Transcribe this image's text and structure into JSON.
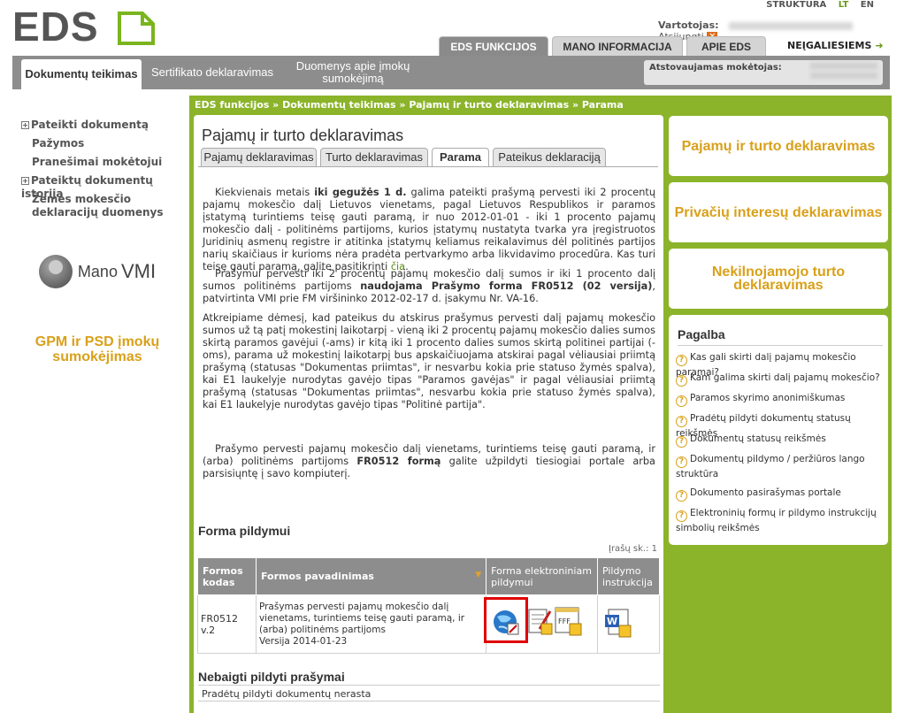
{
  "header": {
    "logo_text": "EDS",
    "top_links": [
      "STRUKTŪRA",
      "LT",
      "EN"
    ],
    "user_label": "Vartotojas:",
    "logout": "Atsijungti",
    "main_tabs": [
      "EDS FUNKCIJOS",
      "MANO INFORMACIJA",
      "APIE EDS"
    ],
    "accessibility": "NEĮGALIESIEMS",
    "sub_tabs": [
      "Dokumentų teikimas",
      "Sertifikato deklaravimas",
      "Duomenys apie įmokų sumokėjimą"
    ],
    "taxpayer_label": "Atstovaujamas mokėtojas:"
  },
  "sidebar": {
    "items": [
      "Pateikti dokumentą",
      "Pažymos",
      "Pranešimai mokėtojui",
      "Pateiktų dokumentų istorija",
      "Žemės mokesčio deklaracijų duomenys"
    ],
    "vmi_mano": "Mano",
    "vmi_name": "VMI",
    "gpm_box": "GPM ir PSD įmokų sumokėjimas"
  },
  "breadcrumb": "EDS funkcijos » Dokumentų teikimas » Pajamų ir turto deklaravimas » Parama",
  "page_title": "Pajamų ir turto deklaravimas",
  "content_tabs": [
    "Pajamų deklaravimas",
    "Turto deklaravimas",
    "Parama",
    "Pateikus deklaraciją"
  ],
  "paragraphs": {
    "p1_a": "Kiekvienais metais ",
    "p1_b": "iki gegužės 1 d.",
    "p1_c": " galima pateikti prašymą pervesti iki 2 procentų pajamų mokesčio dalį Lietuvos vienetams, pagal Lietuvos Respublikos ir paramos įstatymą turintiems teisę gauti paramą, ir nuo 2012-01-01 - iki 1 procento pajamų mokesčio dalį - politinėms partijoms, kurios įstatymų nustatyta tvarka yra įregistruotos Juridinių asmenų registre ir atitinka įstatymų keliamus reikalavimus dėl politinės partijos narių skaičiaus ir kurioms nėra pradėta pertvarkymo arba likvidavimo procedūra. Kas turi teisę gauti paramą, galite pasitikrinti ",
    "p1_link": "čia",
    "p1_d": ".",
    "p2_a": "Prašymui pervesti iki 2 procentų pajamų mokesčio dalį sumos ir iki 1 procento dalį sumos politinėms partijoms ",
    "p2_b": "naudojama Prašymo forma FR0512 (02 versija)",
    "p2_c": ", patvirtinta VMI prie FM viršininko 2012-02-17 d. įsakymu Nr. VA-16.",
    "p3": "Atkreipiame dėmesį, kad pateikus du atskirus prašymus pervesti dalį pajamų mokesčio sumos už tą patį mokestinį laikotarpį - vieną iki 2 procentų pajamų mokesčio dalies sumos skirtą paramos gavėjui (-ams) ir kitą iki 1 procento dalies sumos skirtą politinei partijai (-oms), parama už mokestinį laikotarpį bus apskaičiuojama atskirai pagal vėliausiai priimtą prašymą (statusas \"Dokumentas priimtas\", ir nesvarbu kokia prie statuso žymės spalva), kai E1 laukelyje nurodytas gavėjo tipas \"Paramos gavėjas\" ir pagal vėliausiai priimtą prašymą (statusas \"Dokumentas priimtas\", nesvarbu kokia prie statuso žymės spalva), kai E1 laukelyje nurodytas gavėjo tipas \"Politinė partija\".",
    "p4_a": "Prašymo pervesti pajamų mokesčio dalį vienetams, turintiems teisę gauti paramą, ir (arba) politinėms partijoms ",
    "p4_b": "FR0512 formą",
    "p4_c": " galite užpildyti tiesiogiai portale arba parsisiųntę į savo kompiuterį."
  },
  "form_section": {
    "title": "Forma pildymui",
    "count": "Įrašų sk.: 1",
    "headers": [
      "Formos kodas",
      "Formos pavadinimas",
      "Forma elektroniniam pildymui",
      "Pildymo instrukcija"
    ],
    "rows": [
      {
        "code": "FR0512 v.2",
        "name": "Prašymas pervesti pajamų mokesčio dalį vienetams, turintiems teisę gauti paramą, ir (arba) politinėms partijoms",
        "version": "Versija 2014-01-23"
      }
    ]
  },
  "unfinished": {
    "title": "Nebaigti pildyti prašymai",
    "empty": "Pradėtų pildyti dokumentų nerasta"
  },
  "right_boxes": [
    "Pajamų ir turto deklaravimas",
    "Privačių interesų deklaravimas",
    "Nekilnojamojo turto deklaravimas"
  ],
  "help": {
    "title": "Pagalba",
    "items": [
      "Kas gali skirti dalį pajamų mokesčio paramai?",
      "Kam galima skirti dalį pajamų mokesčio?",
      "Paramos skyrimo anonimiškumas",
      "Pradėtų pildyti dokumentų statusų reikšmės",
      "Dokumentų statusų reikšmės",
      "Dokumentų pildymo / peržiūros lango struktūra",
      "Dokumento pasirašymas portale",
      "Elektroninių formų ir pildymo instrukcijų simbolių reikšmės"
    ]
  },
  "colors": {
    "green": "#8bb42a",
    "gold": "#d9a01a",
    "gray": "#8d8d8d"
  }
}
